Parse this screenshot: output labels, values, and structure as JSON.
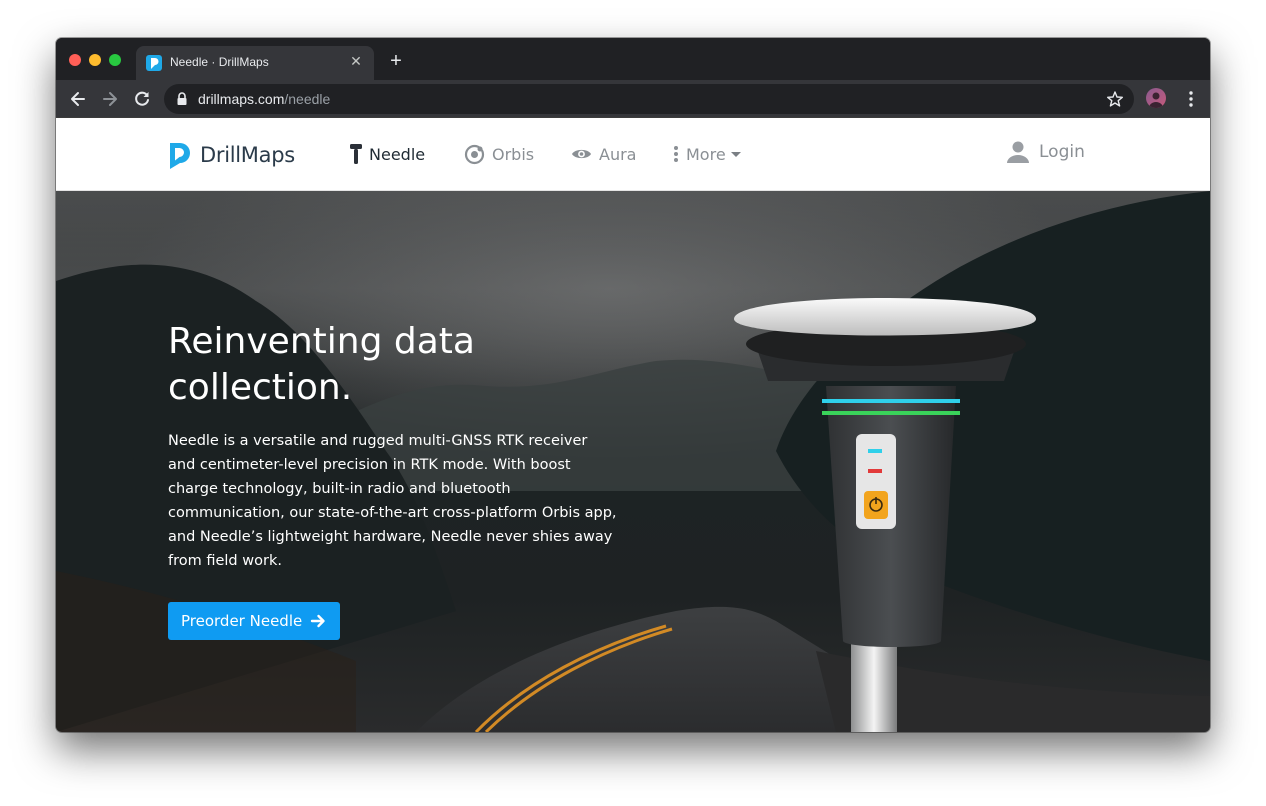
{
  "browser": {
    "tab_title": "Needle · DrillMaps",
    "new_tab_label": "+",
    "close_label": "✕",
    "url_domain": "drillmaps.com",
    "url_path": "/needle"
  },
  "site": {
    "logo_text": "DrillMaps",
    "brand_color": "#1fa9e8",
    "nav": {
      "needle": "Needle",
      "orbis": "Orbis",
      "aura": "Aura",
      "more": "More"
    },
    "login": "Login"
  },
  "hero": {
    "title": "Reinventing data collection.",
    "body": "Needle is a versatile and rugged multi-GNSS RTK receiver and centimeter-level precision in RTK mode. With boost charge technology, built-in radio and bluetooth communication, our state-of-the-art cross-platform Orbis app, and Needle’s lightweight hardware, Needle never shies away from field work.",
    "cta_label": "Preorder Needle",
    "cta_color": "#0f9bf2"
  }
}
